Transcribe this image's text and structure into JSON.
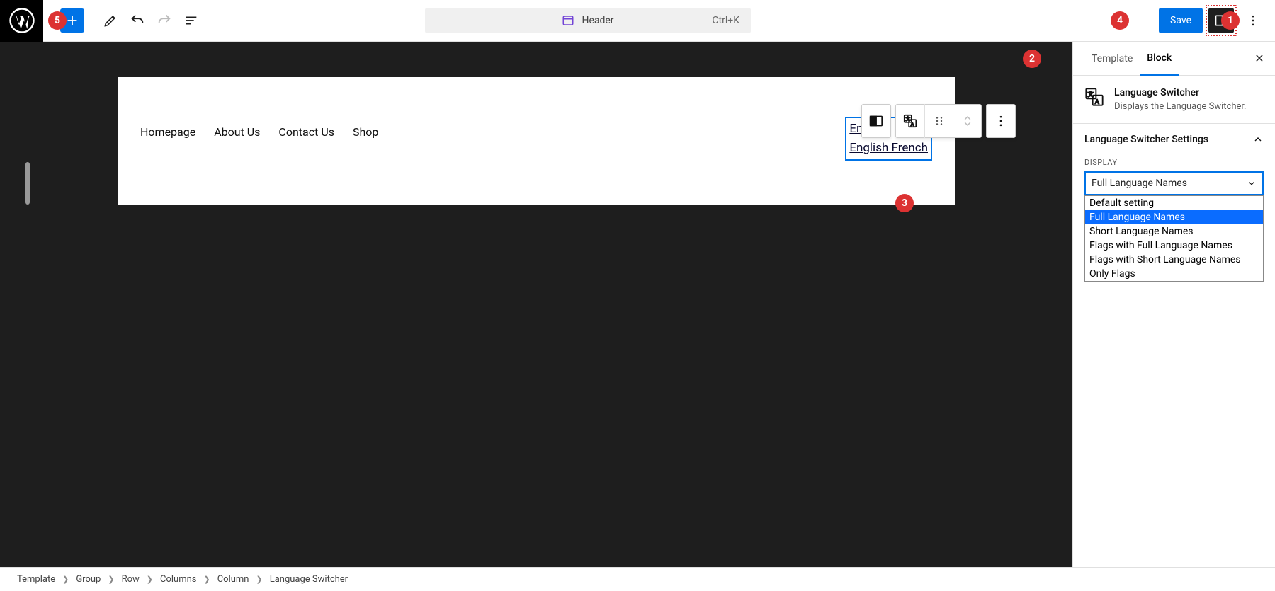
{
  "toolbar": {
    "center_label": "Header",
    "center_shortcut": "Ctrl+K",
    "save_label": "Save"
  },
  "nav": [
    "Homepage",
    "About Us",
    "Contact Us",
    "Shop"
  ],
  "langswitch": {
    "line1": "English",
    "line2": "English French"
  },
  "sidepanel": {
    "tabs": {
      "template": "Template",
      "block": "Block"
    },
    "block": {
      "title": "Language Switcher",
      "desc": "Displays the Language Switcher."
    },
    "section_title": "Language Switcher Settings",
    "field_label": "Display",
    "selected": "Full Language Names",
    "options": [
      "Default setting",
      "Full Language Names",
      "Short Language Names",
      "Flags with Full Language Names",
      "Flags with Short Language Names",
      "Only Flags"
    ]
  },
  "breadcrumb": [
    "Template",
    "Group",
    "Row",
    "Columns",
    "Column",
    "Language Switcher"
  ],
  "badges": {
    "b1": "1",
    "b2": "2",
    "b3": "3",
    "b4": "4",
    "b5": "5"
  }
}
